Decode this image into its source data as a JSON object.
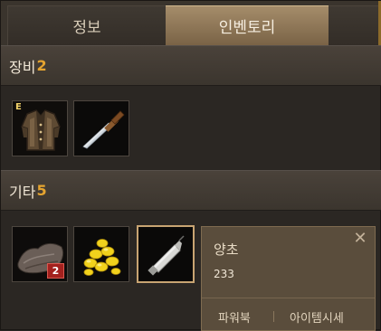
{
  "tabs": [
    {
      "label": "정보",
      "active": false
    },
    {
      "label": "인벤토리",
      "active": true
    }
  ],
  "sections": {
    "equipment": {
      "label": "장비",
      "count": "2"
    },
    "misc": {
      "label": "기타",
      "count": "5"
    }
  },
  "equipment_items": [
    {
      "icon": "jacket-icon",
      "badge": "E"
    },
    {
      "icon": "knife-icon"
    }
  ],
  "misc_items": [
    {
      "icon": "leather-icon",
      "count": "2"
    },
    {
      "icon": "gold-coins-icon"
    },
    {
      "icon": "candle-icon",
      "selected": true
    }
  ],
  "tooltip": {
    "name": "양초",
    "value": "233",
    "actions": [
      "파워북",
      "아이템시세"
    ]
  },
  "colors": {
    "accent_count": "#e5a430",
    "active_tab": "#8f7656",
    "badge_red": "#a3211e"
  }
}
